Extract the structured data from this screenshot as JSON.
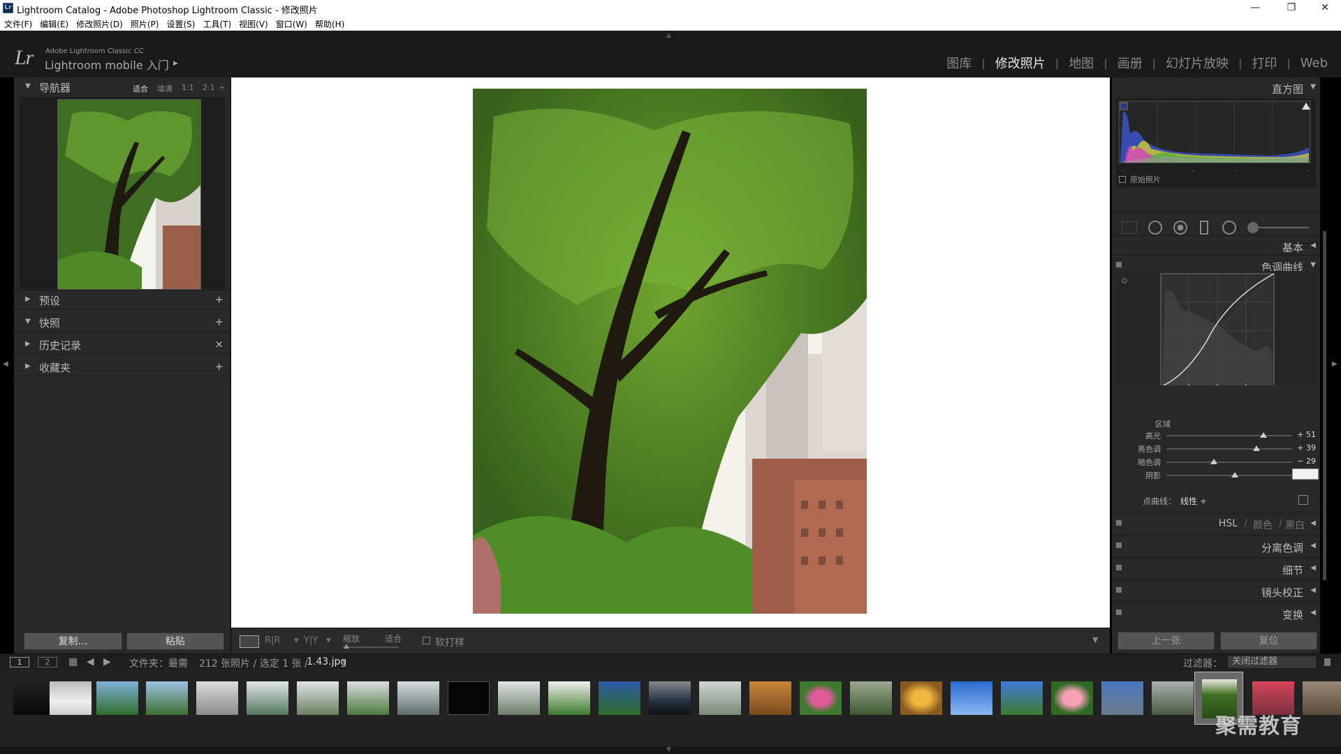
{
  "window": {
    "title": "Lightroom Catalog - Adobe Photoshop Lightroom Classic - 修改照片",
    "app_icon_text": "Lr",
    "controls": {
      "minimize": "—",
      "restore": "❐",
      "close": "✕"
    }
  },
  "menubar": [
    "文件(F)",
    "编辑(E)",
    "修改照片(D)",
    "照片(P)",
    "设置(S)",
    "工具(T)",
    "视图(V)",
    "窗口(W)",
    "帮助(H)"
  ],
  "identity": {
    "logo": "Lr",
    "edition": "Adobe Lightroom Classic CC",
    "mobile": "Lightroom mobile 入门",
    "mobile_arrow": "▶"
  },
  "modules": [
    {
      "label": "图库",
      "active": false
    },
    {
      "label": "修改照片",
      "active": true
    },
    {
      "label": "地图",
      "active": false
    },
    {
      "label": "画册",
      "active": false
    },
    {
      "label": "幻灯片放映",
      "active": false
    },
    {
      "label": "打印",
      "active": false
    },
    {
      "label": "Web",
      "active": false
    }
  ],
  "left_panel": {
    "navigator": {
      "title": "导航器",
      "zoom_options": [
        "适合",
        "填满",
        "1:1",
        "2:1"
      ],
      "active_zoom": "适合",
      "zoom_menu": "÷"
    },
    "panels": [
      {
        "label": "预设",
        "expanded": false,
        "action": "+"
      },
      {
        "label": "快照",
        "expanded": true,
        "action": "+"
      },
      {
        "label": "历史记录",
        "expanded": false,
        "action": "×"
      },
      {
        "label": "收藏夹",
        "expanded": false,
        "action": "+"
      }
    ],
    "copy_label": "复制...",
    "paste_label": "粘贴"
  },
  "toolbar": {
    "ry_label": "R|R",
    "yy_label": "Y|Y",
    "zoom_label": "缩放",
    "fit_label": "适合",
    "softproof_label": "软打样"
  },
  "right_panel": {
    "histogram": {
      "title": "直方图",
      "original_label": "原始照片"
    },
    "basic_label": "基本",
    "tone_curve": {
      "title": "色调曲线",
      "region_title": "区域",
      "sliders": [
        {
          "label": "高光",
          "value": "+ 51",
          "level": 0.78
        },
        {
          "label": "亮色调",
          "value": "+ 39",
          "level": 0.72
        },
        {
          "label": "暗色调",
          "value": "− 29",
          "level": 0.38
        },
        {
          "label": "阴影",
          "value": "",
          "level": 0.55
        }
      ],
      "point_curve_label": "点曲线：",
      "point_curve_value": "线性 ÷"
    },
    "hsl": {
      "label": "HSL",
      "color": "颜色",
      "bw": "黑白",
      "sep": "/"
    },
    "sections": [
      "分离色调",
      "细节",
      "镜头校正",
      "变换"
    ],
    "prev_label": "上一张",
    "reset_label": "复位"
  },
  "filmstrip_header": {
    "page1": "1",
    "page2": "2",
    "source": "文件夹：最需",
    "count": "212 张照片 / 选定 1 张 /",
    "filename": "1.43.jpg",
    "filter_label": "过滤器：",
    "filter_value": "关闭过滤器"
  },
  "watermark": "聚需教育",
  "colors": {
    "panel_bg": "#282828",
    "active_text": "#e6e6e6",
    "accent": "#ddd"
  }
}
